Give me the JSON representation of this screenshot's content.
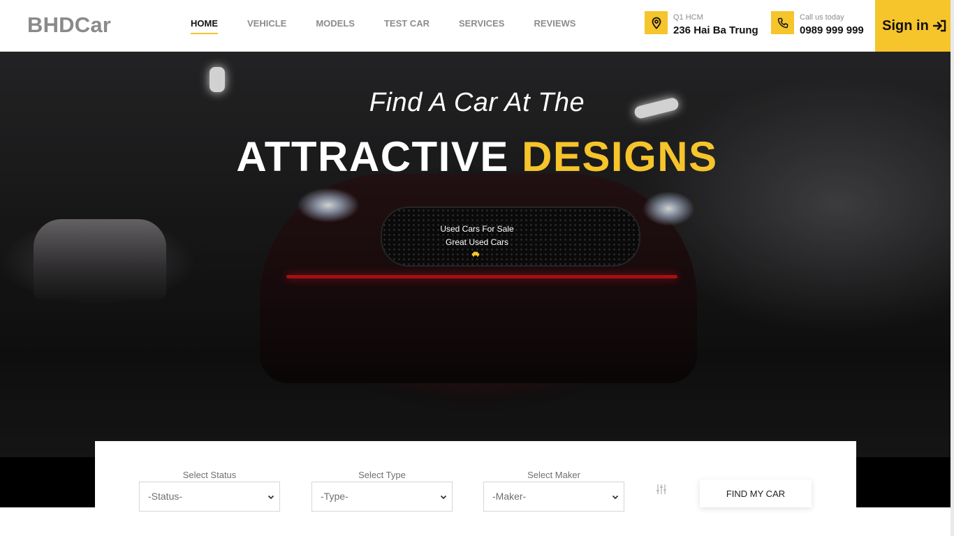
{
  "brand": {
    "logo": "BHDCar",
    "accent_color": "#f6c42b"
  },
  "nav": {
    "items": [
      {
        "label": "HOME",
        "active": true
      },
      {
        "label": "VEHICLE",
        "active": false
      },
      {
        "label": "MODELS",
        "active": false
      },
      {
        "label": "TEST CAR",
        "active": false
      },
      {
        "label": "SERVICES",
        "active": false
      },
      {
        "label": "REVIEWS",
        "active": false
      }
    ]
  },
  "contact": {
    "location_label": "Q1 HCM",
    "address": "236 Hai Ba Trung",
    "location_icon": "map-pin-icon",
    "phone_label": "Call us today",
    "phone": "0989 999 999",
    "phone_icon": "phone-icon"
  },
  "signin": {
    "label": "Sign in",
    "icon": "sign-in-arrow-icon"
  },
  "hero": {
    "line1": "Find A Car At The",
    "line2_white": "ATTRACTIVE",
    "line2_accent": "DESIGNS",
    "sub1": "Used Cars For Sale",
    "sub2": "Great Used Cars",
    "sub_icon": "car-icon"
  },
  "search": {
    "status": {
      "label": "Select Status",
      "value": "-Status-"
    },
    "type": {
      "label": "Select Type",
      "value": "-Type-"
    },
    "maker": {
      "label": "Select Maker",
      "value": "-Maker-"
    },
    "filter_icon": "sliders-icon",
    "button": "FIND MY CAR"
  }
}
